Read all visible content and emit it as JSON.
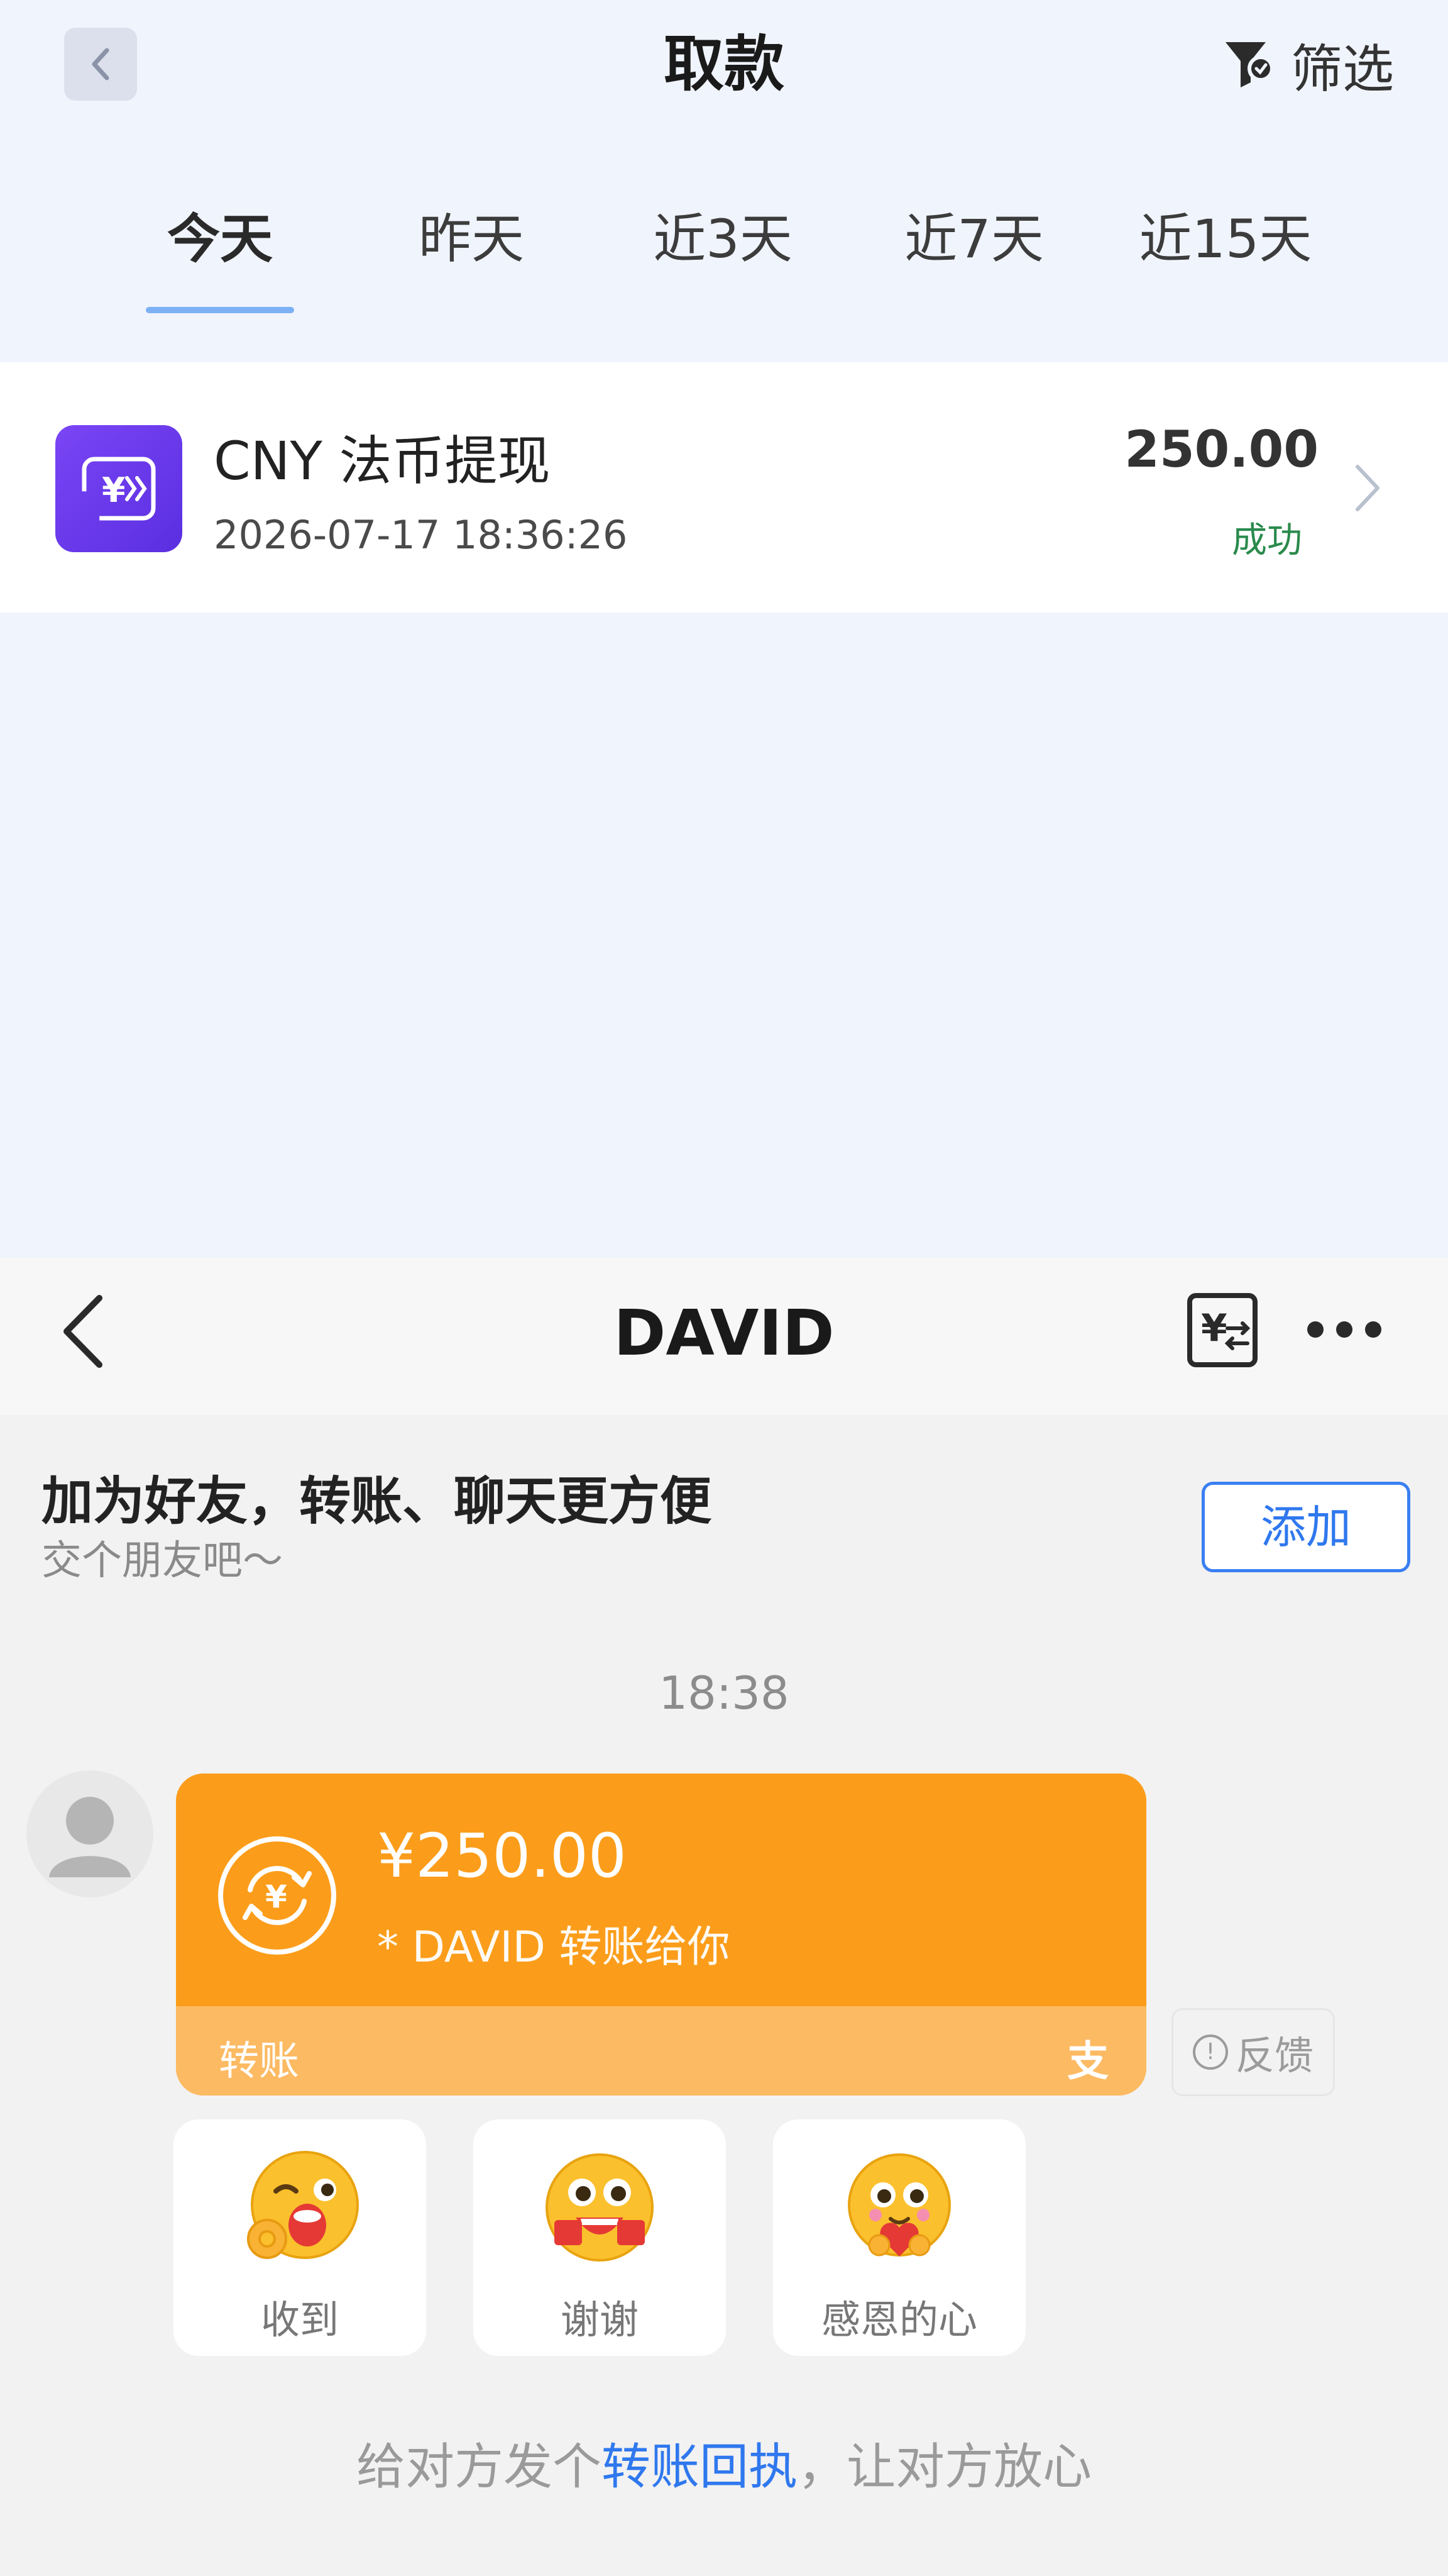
{
  "withdraw": {
    "title": "取款",
    "filter_label": "筛选",
    "tabs": [
      {
        "label": "今天",
        "selected": true
      },
      {
        "label": "昨天",
        "selected": false
      },
      {
        "label": "近3天",
        "selected": false
      },
      {
        "label": "近7天",
        "selected": false
      },
      {
        "label": "近15天",
        "selected": false
      }
    ],
    "records": [
      {
        "icon": "yuan-transfer-icon",
        "title": "CNY 法币提现",
        "time": "2026-07-17 18:36:26",
        "amount": "250.00",
        "status": "成功"
      }
    ]
  },
  "chat": {
    "name": "DAVID",
    "add_friend": {
      "title": "加为好友，转账、聊天更方便",
      "subtitle": "交个朋友吧～",
      "button": "添加"
    },
    "message_time": "18:38",
    "transfer": {
      "amount": "¥250.00",
      "desc": "* DAVID 转账给你",
      "label": "转账",
      "brand": "支"
    },
    "feedback_label": "反馈",
    "quick_replies": [
      {
        "label": "收到",
        "icon": "ok-hand-emoji-icon"
      },
      {
        "label": "谢谢",
        "icon": "thanks-emoji-icon"
      },
      {
        "label": "感恩的心",
        "icon": "grateful-heart-emoji-icon"
      }
    ],
    "receipt": {
      "prefix": "给对方发个",
      "link": "转账回执",
      "suffix": "，让对方放心"
    }
  },
  "colors": {
    "accent_blue": "#2f78ee",
    "transfer_orange": "#fb9d1a",
    "status_green": "#2a8a4c",
    "record_icon_purple": "#6a3af0"
  }
}
